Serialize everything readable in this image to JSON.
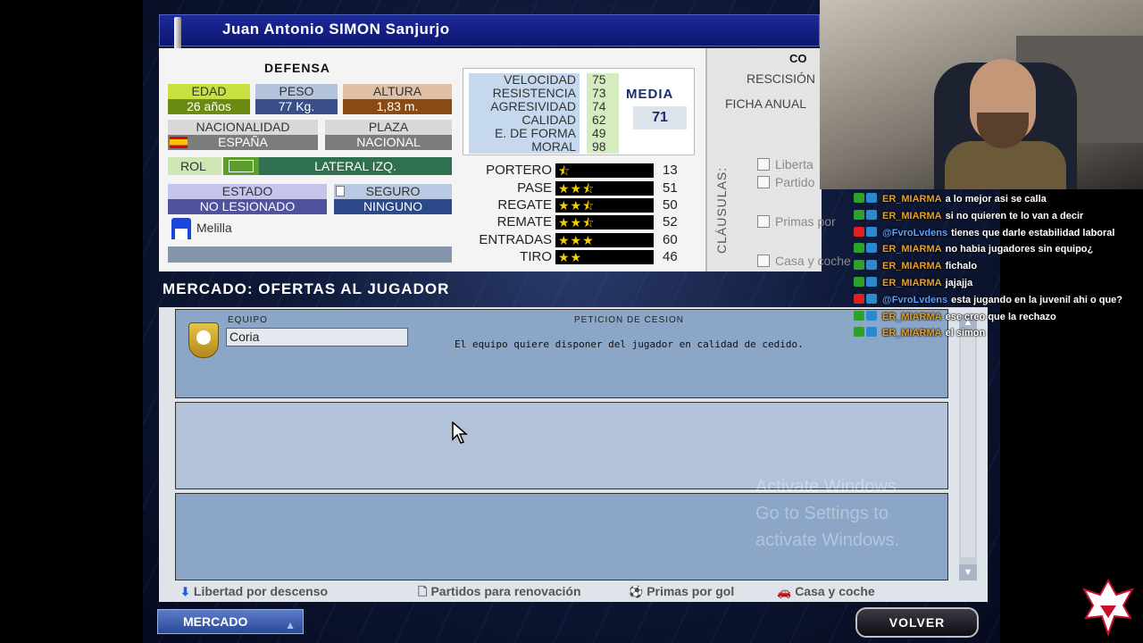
{
  "player": {
    "name": "Juan Antonio SIMON Sanjurjo",
    "position": "DEFENSA",
    "age_label": "EDAD",
    "age": "26 años",
    "weight_label": "PESO",
    "weight": "77 Kg.",
    "height_label": "ALTURA",
    "height": "1,83 m.",
    "nationality_label": "NACIONALIDAD",
    "nationality": "ESPAÑA",
    "slot_label": "PLAZA",
    "slot": "NACIONAL",
    "role_label": "ROL",
    "role": "LATERAL IZQ.",
    "status_label": "ESTADO",
    "status": "NO LESIONADO",
    "insurance_label": "SEGURO",
    "insurance": "NINGUNO",
    "club": "Melilla",
    "attributes": [
      {
        "label": "VELOCIDAD",
        "value": "75"
      },
      {
        "label": "RESISTENCIA",
        "value": "73"
      },
      {
        "label": "AGRESIVIDAD",
        "value": "74"
      },
      {
        "label": "CALIDAD",
        "value": "62"
      },
      {
        "label": "E. DE FORMA",
        "value": "49"
      },
      {
        "label": "MORAL",
        "value": "98"
      }
    ],
    "media_label": "MEDIA",
    "media": "71",
    "skills": [
      {
        "label": "PORTERO",
        "value": "13",
        "stars": "⯪"
      },
      {
        "label": "PASE",
        "value": "51",
        "stars": "★★⯪"
      },
      {
        "label": "REGATE",
        "value": "50",
        "stars": "★★⯪"
      },
      {
        "label": "REMATE",
        "value": "52",
        "stars": "★★⯪"
      },
      {
        "label": "ENTRADAS",
        "value": "60",
        "stars": "★★★"
      },
      {
        "label": "TIRO",
        "value": "46",
        "stars": "★★"
      }
    ]
  },
  "contract": {
    "title": "CO",
    "rescision": "RESCISIÓN",
    "ficha": "FICHA ANUAL",
    "clauses_label": "CLÁUSULAS:",
    "clauses": [
      "Liberta",
      "Partido",
      "Primas por",
      "Casa y coche"
    ]
  },
  "market": {
    "title": "MERCADO: OFERTAS AL JUGADOR",
    "col_team": "EQUIPO",
    "col_request": "PETICION DE CESION",
    "offers": [
      {
        "team": "Coria",
        "text": "El equipo quiere disponer del jugador en calidad de cedido."
      }
    ],
    "legend": [
      {
        "icon": "arrow-down-icon",
        "label": "Libertad por descenso"
      },
      {
        "icon": "document-icon",
        "label": "Partidos para renovación"
      },
      {
        "icon": "ball-icon",
        "label": "Primas por gol"
      },
      {
        "icon": "car-icon",
        "label": "Casa y coche"
      }
    ]
  },
  "buttons": {
    "mercado": "MERCADO",
    "volver": "VOLVER"
  },
  "watermark": {
    "line1": "Activate Windows",
    "line2": "Go to Settings to",
    "line3": "activate Windows."
  },
  "chat": [
    {
      "user": "ER_MIARMA",
      "color": "#e8a020",
      "text": "a lo mejor asi se calla"
    },
    {
      "user": "ER_MIARMA",
      "color": "#e8a020",
      "text": "si no quieren te lo van a decir"
    },
    {
      "user": "@FvroLvdens",
      "color": "#5aa0ff",
      "text": "tienes que darle estabilidad laboral"
    },
    {
      "user": "ER_MIARMA",
      "color": "#e8a020",
      "text": "no habia jugadores sin equipo¿"
    },
    {
      "user": "ER_MIARMA",
      "color": "#e8a020",
      "text": "fichalo"
    },
    {
      "user": "ER_MIARMA",
      "color": "#e8a020",
      "text": "jajajja"
    },
    {
      "user": "@FvroLvdens",
      "color": "#5aa0ff",
      "text": "esta jugando en la juvenil ahi o que?"
    },
    {
      "user": "ER_MIARMA",
      "color": "#e8a020",
      "text": "ese creo que la rechazo"
    },
    {
      "user": "ER_MIARMA",
      "color": "#e8a020",
      "text": "el simon"
    }
  ],
  "colors": {
    "age_bg": "#c8e040",
    "age_val_bg": "#6a8a14",
    "weight_bg": "#b4c4dc",
    "weight_val_bg": "#3a4e8a",
    "height_bg": "#e0c0a4",
    "height_val_bg": "#8a4a14",
    "role_bg": "#2e7050"
  }
}
